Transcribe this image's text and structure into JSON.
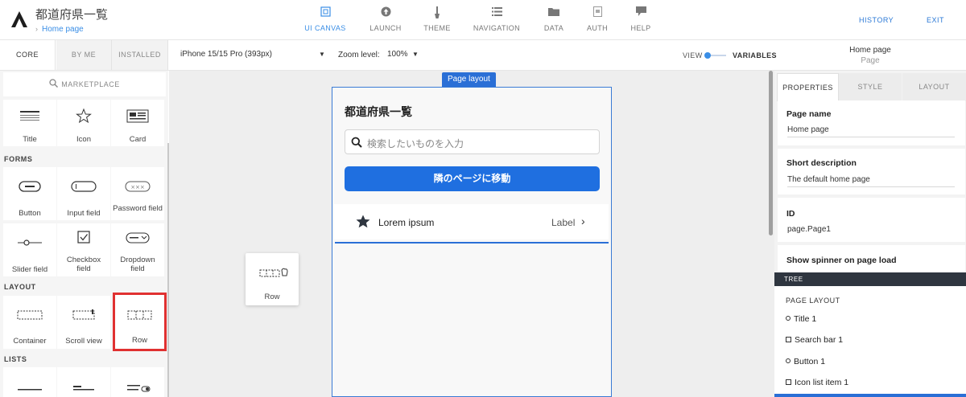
{
  "app": {
    "title": "都道府県一覧",
    "breadcrumb": "Home page"
  },
  "nav": {
    "tabs": [
      {
        "label": "UI CANVAS",
        "icon": "canvas-icon",
        "active": true
      },
      {
        "label": "LAUNCH",
        "icon": "upload-icon"
      },
      {
        "label": "THEME",
        "icon": "brush-icon"
      },
      {
        "label": "NAVIGATION",
        "icon": "list-icon"
      },
      {
        "label": "DATA",
        "icon": "folder-icon"
      },
      {
        "label": "AUTH",
        "icon": "auth-document-icon"
      },
      {
        "label": "HELP",
        "icon": "chat-icon"
      }
    ],
    "history": "HISTORY",
    "exit": "EXIT"
  },
  "toolbar": {
    "device": "iPhone 15/15 Pro (393px)",
    "zoom_label": "Zoom level:",
    "zoom_value": "100%",
    "view_label": "VIEW",
    "variables_label": "VARIABLES",
    "page_name": "Home page",
    "page_type": "Page"
  },
  "left": {
    "tabs": [
      "CORE",
      "BY ME",
      "INSTALLED"
    ],
    "marketplace": "MARKETPLACE",
    "sections": {
      "forms": "FORMS",
      "layout": "LAYOUT",
      "lists": "LISTS"
    },
    "core": [
      "Title",
      "Icon",
      "Card"
    ],
    "forms": [
      "Button",
      "Input field",
      "Password field",
      "Slider field",
      "Checkbox field",
      "Dropdown field"
    ],
    "layout": [
      "Container",
      "Scroll view",
      "Row"
    ]
  },
  "canvas": {
    "badge": "Page layout",
    "title": "都道府県一覧",
    "search_placeholder": "検索したいものを入力",
    "button": "隣のページに移動",
    "list_title": "Lorem ipsum",
    "list_label": "Label",
    "drag_label": "Row"
  },
  "right": {
    "tabs": [
      "PROPERTIES",
      "STYLE",
      "LAYOUT"
    ],
    "page_name_label": "Page name",
    "page_name_value": "Home page",
    "short_desc_label": "Short description",
    "short_desc_value": "The default home page",
    "id_label": "ID",
    "id_value": "page.Page1",
    "spinner_label": "Show spinner on page load",
    "tree_header": "TREE",
    "tree_title": "PAGE LAYOUT",
    "tree_items": [
      "Title 1",
      "Search bar 1",
      "Button 1",
      "Icon list item 1"
    ]
  },
  "colors": {
    "accent": "#3a8ee6",
    "primary_button": "#1f6fe0",
    "highlight": "#e03131",
    "tree_header": "#2f3640"
  }
}
